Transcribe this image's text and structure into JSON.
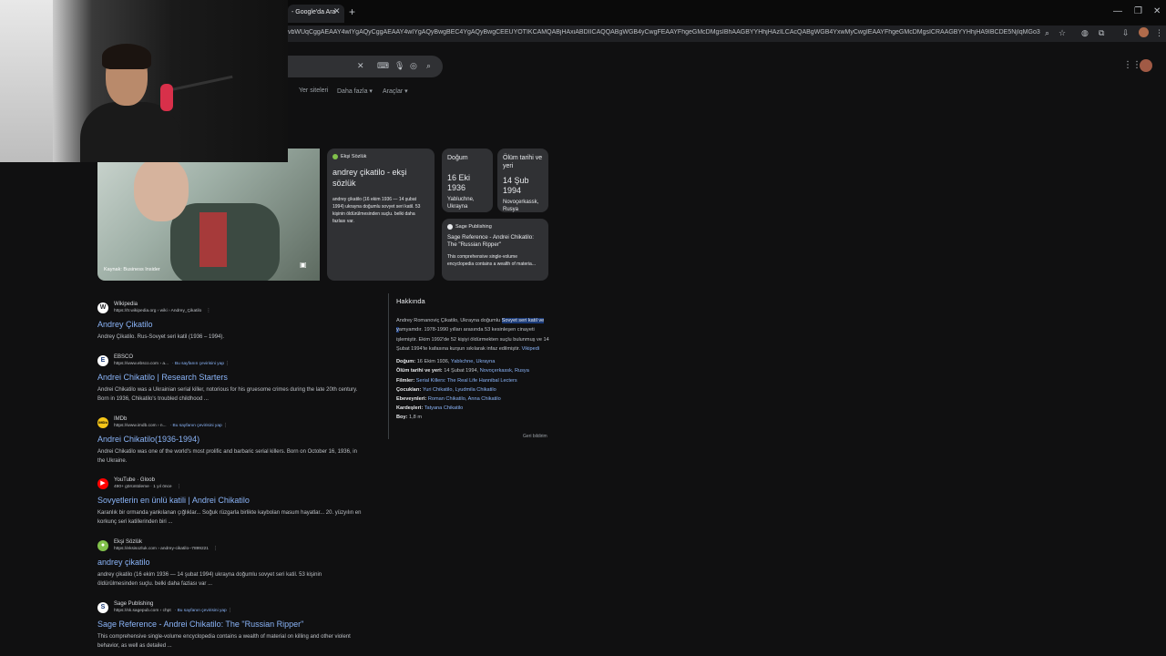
{
  "browser": {
    "tab_title": "- Google'da Ara",
    "url": "vbWUqCggAEAAY4wIYgAQyCggAEAAY4wIYgAQyBwgBEC4YgAQyBwgCEEUYOTIKCAMQABjHAxiABDIICAQQABgWGB4yCwgFEAAYFhgeGMcDMgsIBhAAGBYYHhjHAzILCAcQABgWGB4YxwMyCwgIEAAYFhgeGMcDMgsICRAAGBYYHhjHA9IBCDE5NjIqMGo3qAIAsAIA&client=gws-wiz-serp"
  },
  "search": {
    "tabs": [
      "Yer siteleri",
      "Daha fazla",
      "Araçlar"
    ]
  },
  "image": {
    "caption": "Kaynak: Business Insider"
  },
  "cards": {
    "eksi": {
      "source": "Ekşi Sözlük",
      "title": "andrey çikatilo - ekşi sözlük",
      "desc": "andrey çikatilo (16 ekim 1936 — 14 şubat 1994) ukrayna doğumlu sovyet seri katil. 53 kişinin öldürülmesinden suçlu. belki daha fazlası var."
    },
    "birth": {
      "label": "Doğum",
      "date": "16 Eki 1936",
      "place": "Yabluchne, Ukrayna"
    },
    "death": {
      "label": "Ölüm tarihi ve yeri",
      "date": "14 Şub 1994",
      "place": "Novoçerkassk, Rusya"
    },
    "sage": {
      "source": "Sage Publishing",
      "title": "Sage Reference - Andrei Chikatilo: The \"Russian Ripper\"",
      "desc": "This comprehensive single-volume encyclopedia contains a wealth of materia..."
    }
  },
  "results": [
    {
      "site": "Wikipedia",
      "url": "https://tr.wikipedia.org › wiki › Andrey_Çikatilo",
      "translate": "",
      "title": "Andrey Çikatilo",
      "snippet": "Andrey Çikatilo. Rus-Sovyet seri katil (1936 – 1994).",
      "fav": "W",
      "fav_bg": "#ffffff",
      "fav_fg": "#202124"
    },
    {
      "site": "EBSCO",
      "url": "https://www.ebsco.com › a...",
      "translate": "· Bu sayfanın çevirisini yap",
      "title": "Andrei Chikatilo | Research Starters",
      "snippet": "Andrei Chikatilo was a Ukrainian serial killer, notorious for his gruesome crimes during the late 20th century. Born in 1936, Chikatilo's troubled childhood ...",
      "fav": "E",
      "fav_bg": "#ffffff",
      "fav_fg": "#1a3a78"
    },
    {
      "site": "IMDb",
      "url": "https://www.imdb.com › n...",
      "translate": "· Bu sayfanın çevirisini yap",
      "title": "Andrei Chikatilo(1936-1994)",
      "snippet": "Andrei Chikatilo was one of the world's most prolific and barbaric serial killers. Born on October 16, 1936, in the Ukraine.",
      "fav": "IMDb",
      "fav_bg": "#f5c518",
      "fav_fg": "#000000"
    },
    {
      "site": "YouTube · Gloob",
      "url": "490+ görüntüleme · 1 yıl önce",
      "translate": "",
      "title": "Sovyetlerin en ünlü katili | Andrei Chikatilo",
      "snippet": "Karanlık bir ormanda yankılanan çığlıklar... Soğuk rüzgarla birlikte kaybolan masum hayatlar... 20. yüzyılın en korkunç seri katillerinden biri ...",
      "fav": "▶",
      "fav_bg": "#ff0000",
      "fav_fg": "#ffffff"
    },
    {
      "site": "Ekşi Sözlük",
      "url": "https://eksisozluk.com › andrey-cikatilo--7899221",
      "translate": "",
      "title": "andrey çikatilo",
      "snippet": "andrey çikatilo (16 ekim 1936 — 14 şubat 1994) ukrayna doğumlu sovyet seri katil. 53 kişinin öldürülmesinden suçlu. belki daha fazlası var ...",
      "fav": "●",
      "fav_bg": "#81c14b",
      "fav_fg": "#ffffff"
    },
    {
      "site": "Sage Publishing",
      "url": "https://sk.sagepub.com › chpt",
      "translate": "· Bu sayfanın çevirisini yap",
      "title": "Sage Reference - Andrei Chikatilo: The \"Russian Ripper\"",
      "snippet": "This comprehensive single-volume encyclopedia contains a wealth of material on killing and other violent behavior, as well as detailed ...",
      "fav": "S",
      "fav_bg": "#ffffff",
      "fav_fg": "#1a3a78"
    }
  ],
  "knowledge_panel": {
    "title": "Hakkında",
    "desc_pre": "Andrey Romanoviç Çikatilo, Ukrayna doğumlu ",
    "desc_highlight": "Sovyet seri katil ve y",
    "desc_post": "amyamdır. 1978-1990 yılları arasında 53 kesinleşen cinayeti işlemiştir. Ekim 1992'de 52 kişiyi öldürmekten suçlu bulunmuş ve 14 Şubat 1994'te kafasına kurşun sıkılarak infaz edilmiştir. ",
    "desc_link": "Vikipedi",
    "facts": [
      {
        "label": "Doğum:",
        "plain": " 16 Ekim 1936, ",
        "link": "Yablıchne, Ukrayna"
      },
      {
        "label": "Ölüm tarihi ve yeri:",
        "plain": " 14 Şubat 1994, ",
        "link": "Novoçerkassk, Rusya"
      },
      {
        "label": "Filmler:",
        "plain": " ",
        "link": "Serial Killers: The Real Life Hannibal Lecters"
      },
      {
        "label": "Çocukları:",
        "plain": " ",
        "link": "Yuri Chikatilo, Lyudmila Chikatilo"
      },
      {
        "label": "Ebeveynleri:",
        "plain": " ",
        "link": "Roman Chikatilo, Anna Chikatilo"
      },
      {
        "label": "Kardeşleri:",
        "plain": " ",
        "link": "Tatyana Chikatilo"
      },
      {
        "label": "Boy:",
        "plain": " 1,8 m",
        "link": ""
      }
    ],
    "feedback": "Geri bildirim"
  }
}
